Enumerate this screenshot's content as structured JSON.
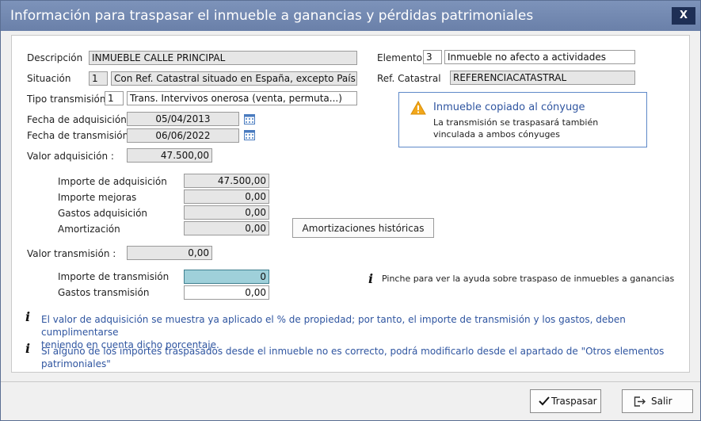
{
  "window": {
    "title": "Información para traspasar el inmueble a ganancias y pérdidas patrimoniales",
    "close_label": "X"
  },
  "form": {
    "descripcion_label": "Descripción",
    "descripcion_value": "INMUEBLE CALLE PRINCIPAL",
    "situacion_label": "Situación",
    "situacion_code": "1",
    "situacion_text": "Con Ref. Catastral situado en España, excepto País Vas",
    "tipo_label": "Tipo transmisión",
    "tipo_code": "1",
    "tipo_text": "Trans. Intervivos onerosa (venta, permuta...)",
    "fecha_adq_label": "Fecha de adquisición",
    "fecha_adq_value": "05/04/2013",
    "fecha_trans_label": "Fecha de transmisión",
    "fecha_trans_value": "06/06/2022",
    "valor_adq_label": "Valor adquisición :",
    "valor_adq_value": "47.500,00",
    "elemento_label": "Elemento",
    "elemento_code": "3",
    "elemento_text": "Inmueble no afecto a actividades",
    "refcat_label": "Ref. Catastral",
    "refcat_value": "REFERENCIACATASTRAL",
    "importe_adq_label": "Importe de adquisición",
    "importe_adq_value": "47.500,00",
    "mejoras_label": "Importe mejoras",
    "mejoras_value": "0,00",
    "gastos_adq_label": "Gastos adquisición",
    "gastos_adq_value": "0,00",
    "amort_label": "Amortización",
    "amort_value": "0,00",
    "amort_hist_button": "Amortizaciones históricas",
    "valor_trans_label": "Valor transmisión :",
    "valor_trans_value": "0,00",
    "importe_trans_label": "Importe de transmisión",
    "importe_trans_value": "0",
    "gastos_trans_label": "Gastos transmisión",
    "gastos_trans_value": "0,00"
  },
  "alert": {
    "title": "Inmueble copiado al cónyuge",
    "line1": "La transmisión se traspasará también",
    "line2": "vinculada a ambos cónyuges"
  },
  "help_link": "Pinche para ver la ayuda sobre traspaso de inmuebles a ganancias",
  "notes": {
    "note1_line1": "El valor de adquisición se muestra ya aplicado el % de propiedad; por tanto, el importe de transmisión y los gastos, deben cumplimentarse",
    "note1_line2": "teniendo en cuenta dicho porcentaje.",
    "note2": "Si alguno de los importes traspasados desde el inmueble no es correcto, podrá modificarlo desde el apartado de \"Otros elementos patrimoniales\""
  },
  "footer": {
    "traspasar_label": "Traspasar",
    "salir_label": "Salir"
  },
  "colors": {
    "titlebar": "#6a80a9",
    "close_bg": "#1e2f55",
    "note_text": "#2f55a0",
    "selected_field": "#9fd0da"
  }
}
